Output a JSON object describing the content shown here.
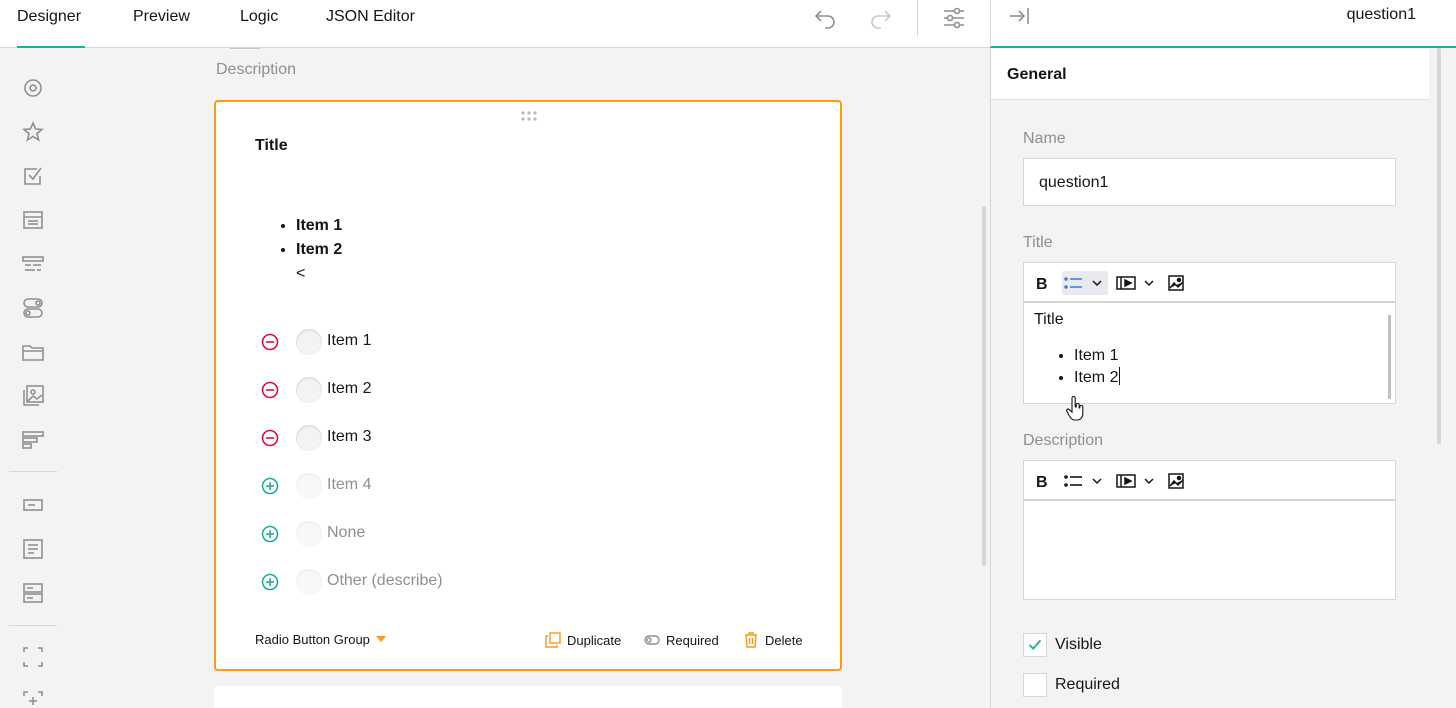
{
  "tabs": [
    {
      "label": "Designer"
    },
    {
      "label": "Preview"
    },
    {
      "label": "Logic"
    },
    {
      "label": "JSON Editor"
    }
  ],
  "toolbar_icons": [
    "undo-icon",
    "redo-icon",
    "settings-sliders-icon"
  ],
  "toolbox": {
    "items": [
      "radiogroup-icon",
      "rating-icon",
      "checkbox-icon",
      "dropdown-icon",
      "tagbox-icon",
      "boolean-icon",
      "file-icon",
      "imagepicker-icon",
      "ranking-icon",
      "text-icon",
      "comment-icon",
      "multipletext-icon",
      "panel-icon",
      "paneldynamic-icon"
    ]
  },
  "survey": {
    "page_description": "Description"
  },
  "question": {
    "title": "Title",
    "title_list": [
      "Item 1",
      "Item 2"
    ],
    "title_trailing": "<",
    "choices": [
      {
        "label": "Item 1",
        "state": "existing"
      },
      {
        "label": "Item 2",
        "state": "existing"
      },
      {
        "label": "Item 3",
        "state": "existing"
      },
      {
        "label": "Item 4",
        "state": "new"
      },
      {
        "label": "None",
        "state": "new"
      },
      {
        "label": "Other (describe)",
        "state": "new"
      }
    ],
    "type_label": "Radio Button Group",
    "actions": {
      "duplicate": "Duplicate",
      "required": "Required",
      "delete": "Delete"
    }
  },
  "property_panel": {
    "selected_name": "question1",
    "section": "General",
    "name_label": "Name",
    "name_value": "question1",
    "title_label": "Title",
    "title_content": {
      "text": "Title",
      "list": [
        "Item 1",
        "Item 2"
      ]
    },
    "description_label": "Description",
    "visible_label": "Visible",
    "visible_checked": true,
    "required_label": "Required",
    "required_checked": false
  },
  "colors": {
    "accent": "#19b394",
    "selection": "#ff9814",
    "remove": "#e50a3e",
    "add": "#19b394"
  }
}
